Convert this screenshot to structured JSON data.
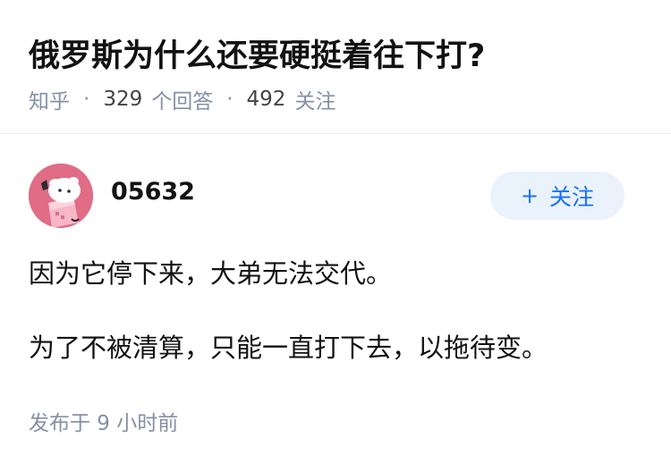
{
  "question": {
    "title": "俄罗斯为什么还要硬挺着往下打?",
    "source": "知乎",
    "answer_count": "329",
    "answer_label": "个回答",
    "follower_count": "492",
    "follower_label": "关注",
    "separator": "·"
  },
  "author": {
    "name": "05632",
    "follow_plus": "+",
    "follow_label": "关注"
  },
  "answer": {
    "paragraphs": [
      "因为它停下来，大弟无法交代。",
      "为了不被清算，只能一直打下去，以拖待变。"
    ],
    "publish_time": "发布于 9 小时前"
  },
  "colors": {
    "accent": "#1772f6",
    "meta_gray": "#8590a6",
    "avatar_bg": "#e06c86"
  }
}
